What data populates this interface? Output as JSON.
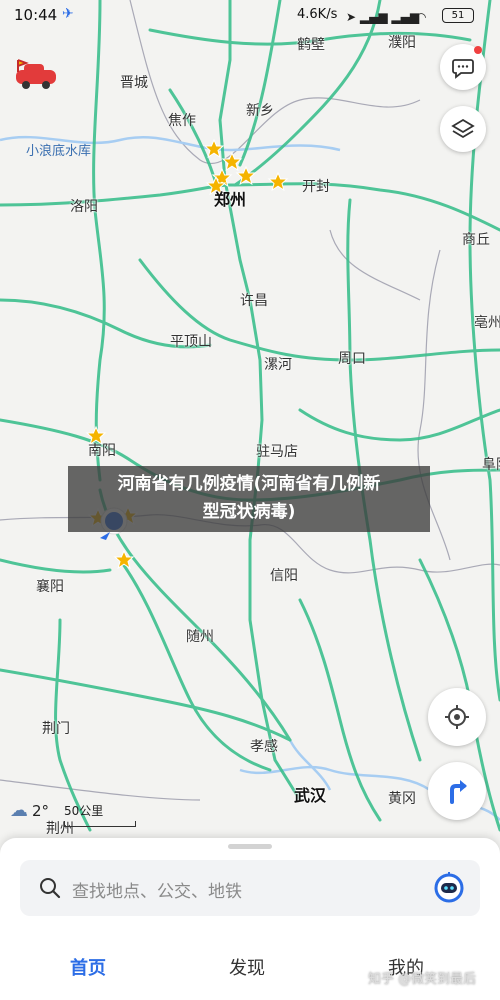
{
  "status_bar": {
    "time": "10:44",
    "speed": "4.6K/s",
    "battery": "51",
    "battery_level": 0.51
  },
  "map": {
    "cities": [
      {
        "id": "hebi",
        "name": "鹤壁"
      },
      {
        "id": "puyang",
        "name": "濮阳"
      },
      {
        "id": "jincheng",
        "name": "晋城"
      },
      {
        "id": "xiaolangdi",
        "name": "小浪底水库"
      },
      {
        "id": "jiaozuo",
        "name": "焦作"
      },
      {
        "id": "xinxiang",
        "name": "新乡"
      },
      {
        "id": "zhengzhou",
        "name": "郑州"
      },
      {
        "id": "kaifeng",
        "name": "开封"
      },
      {
        "id": "luoyang",
        "name": "洛阳"
      },
      {
        "id": "shangqiu",
        "name": "商丘"
      },
      {
        "id": "xuchang",
        "name": "许昌"
      },
      {
        "id": "bozhou",
        "name": "亳州"
      },
      {
        "id": "pingdingshan",
        "name": "平顶山"
      },
      {
        "id": "luohe",
        "name": "漯河"
      },
      {
        "id": "zhoukou",
        "name": "周口"
      },
      {
        "id": "nanyang",
        "name": "南阳"
      },
      {
        "id": "zhumadian",
        "name": "驻马店"
      },
      {
        "id": "fuyang",
        "name": "阜阳"
      },
      {
        "id": "xinyang",
        "name": "信阳"
      },
      {
        "id": "xiangyang",
        "name": "襄阳"
      },
      {
        "id": "suizhou",
        "name": "随州"
      },
      {
        "id": "jingmen",
        "name": "荆门"
      },
      {
        "id": "xiaogan",
        "name": "孝感"
      },
      {
        "id": "wuhan",
        "name": "武汉"
      },
      {
        "id": "huanggang",
        "name": "黄冈"
      },
      {
        "id": "jingzhou",
        "name": "荆州"
      }
    ]
  },
  "banner": {
    "line1": "河南省有几例疫情(河南省有几例新",
    "line2": "型冠状病毒)"
  },
  "weather": {
    "temp": "2°"
  },
  "scale": {
    "label": "50公里"
  },
  "search": {
    "placeholder": "查找地点、公交、地铁"
  },
  "tabs": [
    {
      "label": "首页",
      "active": true
    },
    {
      "label": "发现",
      "active": false
    },
    {
      "label": "我的",
      "active": false
    }
  ],
  "watermark": "知乎 @微笑到最后",
  "colors": {
    "road": "#3dbf8e",
    "accent": "#2c6de6",
    "star": "#f5b400",
    "water": "#a7cdf2"
  },
  "icons": [
    "message-icon",
    "layers-icon",
    "locate-icon",
    "navigate-arrow-icon",
    "search-icon",
    "assistant-robot-icon",
    "car-flag-icon"
  ]
}
